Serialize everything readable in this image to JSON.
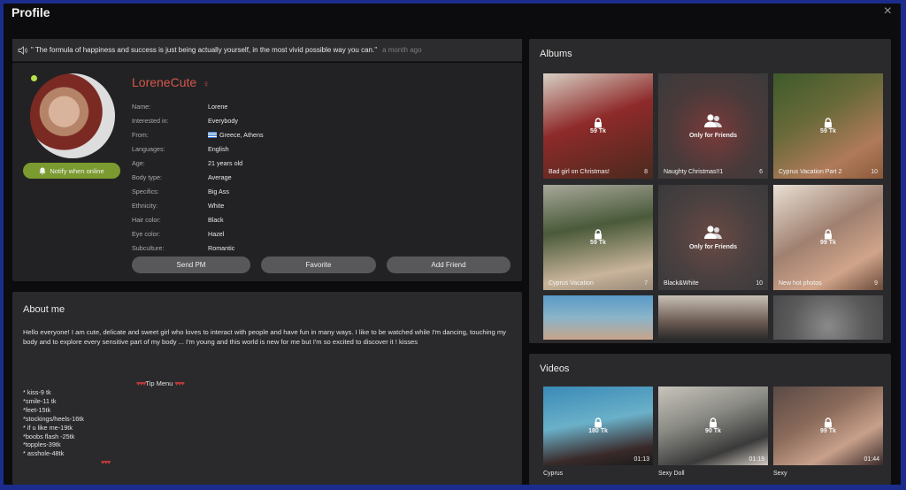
{
  "window": {
    "title": "Profile",
    "close_label": "×"
  },
  "status": {
    "text": "\" The formula of happiness and success is just being actually yourself, in the most vivid possible way you can.\"",
    "time": "a month ago"
  },
  "profile": {
    "username": "LoreneCute",
    "gender_symbol": "♀",
    "notify_label": "Notify when online",
    "fields": [
      {
        "label": "Name:",
        "value": "Lorene"
      },
      {
        "label": "Interested in:",
        "value": "Everybody"
      },
      {
        "label": "From:",
        "value": "Greece, Athens"
      },
      {
        "label": "Languages:",
        "value": "English"
      },
      {
        "label": "Age:",
        "value": "21 years old"
      },
      {
        "label": "Body type:",
        "value": "Average"
      },
      {
        "label": "Specifics:",
        "value": "Big Ass"
      },
      {
        "label": "Ethnicity:",
        "value": "White"
      },
      {
        "label": "Hair color:",
        "value": "Black"
      },
      {
        "label": "Eye color:",
        "value": "Hazel"
      },
      {
        "label": "Subculture:",
        "value": "Romantic"
      }
    ],
    "buttons": {
      "send_pm": "Send PM",
      "favorite": "Favorite",
      "add_friend": "Add Friend"
    },
    "online_color": "#b5e04a",
    "accent_color": "#d6584a"
  },
  "about": {
    "title": "About me",
    "text": "Hello everyone! I am cute, delicate and sweet girl  who loves to interact with people and have fun in many ways. I like to be watched while I'm dancing, touching my body and to explore every sensitive part of my body ... I'm young and this world is new for me  but I'm so excited to discover it ! kisses",
    "tip_hearts": "♥♥♥",
    "tip_title": "Tip Menu",
    "tip_items": [
      "* kiss-9 tk",
      "*smile-11 tk",
      "*feet-15tk",
      "*stockings/heels-16tk",
      "* if u like me-19tk",
      "*boobs flash -25tk",
      "*topples-39tk",
      "* asshole-48tk"
    ],
    "end_hearts": "♥♥♥"
  },
  "albums": {
    "title": "Albums",
    "items": [
      {
        "caption": "Bad girl on Christmas!",
        "count": "8",
        "price": "59 Tk",
        "locked": "price"
      },
      {
        "caption": "Naughty Christmas!!1",
        "count": "6",
        "price": "Only for Friends",
        "locked": "friends"
      },
      {
        "caption": "Cyprus Vacation Part 2",
        "count": "10",
        "price": "59 Tk",
        "locked": "price"
      },
      {
        "caption": "Cyprus Vacation",
        "count": "7",
        "price": "59 Tk",
        "locked": "price"
      },
      {
        "caption": "Black&White",
        "count": "10",
        "price": "Only for Friends",
        "locked": "friends"
      },
      {
        "caption": "New hot photos",
        "count": "9",
        "price": "99 Tk",
        "locked": "price"
      }
    ]
  },
  "videos": {
    "title": "Videos",
    "items": [
      {
        "caption": "Cyprus",
        "price": "180 Tk",
        "duration": "01:13"
      },
      {
        "caption": "Sexy Doll",
        "price": "90 Tk",
        "duration": "01:19"
      },
      {
        "caption": "Sexy",
        "price": "99 Tk",
        "duration": "01:44"
      }
    ]
  }
}
